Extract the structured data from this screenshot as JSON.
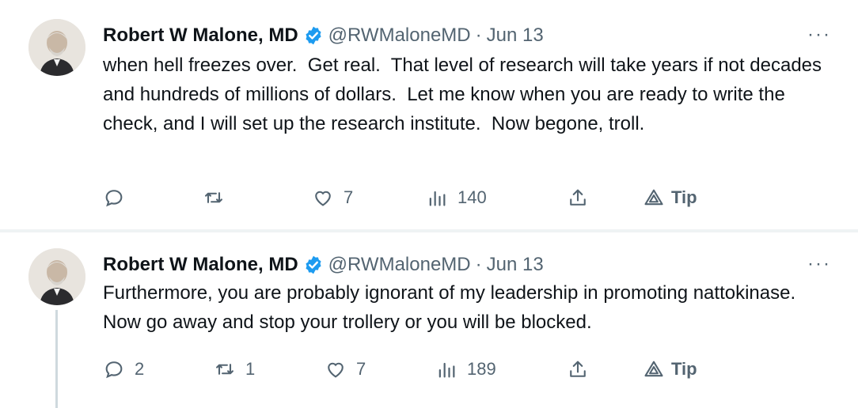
{
  "tweets": [
    {
      "author_name": "Robert W Malone, MD",
      "handle": "@RWMaloneMD",
      "separator": "·",
      "date": "Jun 13",
      "more": "···",
      "text": "when hell freezes over.  Get real.  That level of research will take years if not decades and hundreds of millions of dollars.  Let me know when you are ready to write the check, and I will set up the research institute.  Now begone, troll.",
      "actions": {
        "reply_count": "",
        "retweet_count": "",
        "like_count": "7",
        "view_count": "140",
        "tip_label": "Tip"
      }
    },
    {
      "author_name": "Robert W Malone, MD",
      "handle": "@RWMaloneMD",
      "separator": "·",
      "date": "Jun 13",
      "more": "···",
      "text": "Furthermore, you are probably ignorant of my leadership in promoting nattokinase.  Now go away and stop your trollery or you will be blocked.",
      "actions": {
        "reply_count": "2",
        "retweet_count": "1",
        "like_count": "7",
        "view_count": "189",
        "tip_label": "Tip"
      }
    }
  ],
  "colors": {
    "text_primary": "#0f1419",
    "text_secondary": "#536471",
    "verified_blue": "#1d9bf0",
    "separator": "#eff3f4",
    "thread_line": "#cfd9de"
  },
  "icons": [
    "reply-icon",
    "retweet-icon",
    "like-icon",
    "views-icon",
    "share-icon",
    "tip-icon",
    "verified-badge-icon"
  ]
}
